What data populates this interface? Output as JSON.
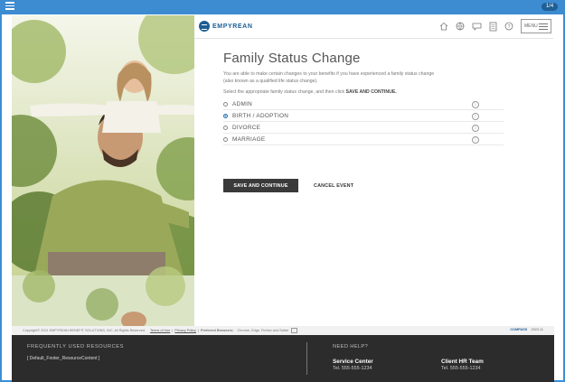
{
  "topbar": {
    "badge": "1/4"
  },
  "brand": {
    "name": "EMPYREAN"
  },
  "header": {
    "icons": [
      "home-icon",
      "globe-icon",
      "chat-icon",
      "document-icon",
      "help-icon"
    ],
    "menu_label": "MENU"
  },
  "page": {
    "title": "Family Status Change",
    "intro": "You are able to make certain changes to your benefits if you have experienced a family status change (also known as a qualified life status change).",
    "instruction_prefix": "Select the appropriate family status change, and then click",
    "instruction_bold": "SAVE AND CONTINUE."
  },
  "options": [
    {
      "label": "ADMIN",
      "selected": false
    },
    {
      "label": "BIRTH / ADOPTION",
      "selected": true
    },
    {
      "label": "DIVORCE",
      "selected": false
    },
    {
      "label": "MARRIAGE",
      "selected": false
    }
  ],
  "actions": {
    "save": "SAVE AND CONTINUE",
    "cancel": "CANCEL EVENT"
  },
  "legal": {
    "copyright": "Copyright© 2021 EMPYREAN BENEFIT SOLUTIONS, INC. All Rights Reserved.",
    "terms": "Terms of Use",
    "privacy": "Privacy Policy",
    "browsers_label": "Preferred Browsers:",
    "browsers": "Chrome, Edge, Firefox and Safari",
    "right_brand": "COMPASS",
    "right_version": "2023.11"
  },
  "footer": {
    "resources_heading": "FREQUENTLY USED RESOURCES",
    "resources_content": "[ Default_Footer_ResourceContent ]",
    "help_heading": "NEED HELP?",
    "contacts": [
      {
        "name": "Service Center",
        "phone": "Tel. 555-555-1234"
      },
      {
        "name": "Client HR Team",
        "phone": "Tel. 555-555-1234"
      }
    ]
  },
  "colors": {
    "accent": "#3d8bd1",
    "brand": "#1d5d95",
    "primary_button": "#3a3a3a",
    "footer_bg": "#2c2c2c"
  }
}
